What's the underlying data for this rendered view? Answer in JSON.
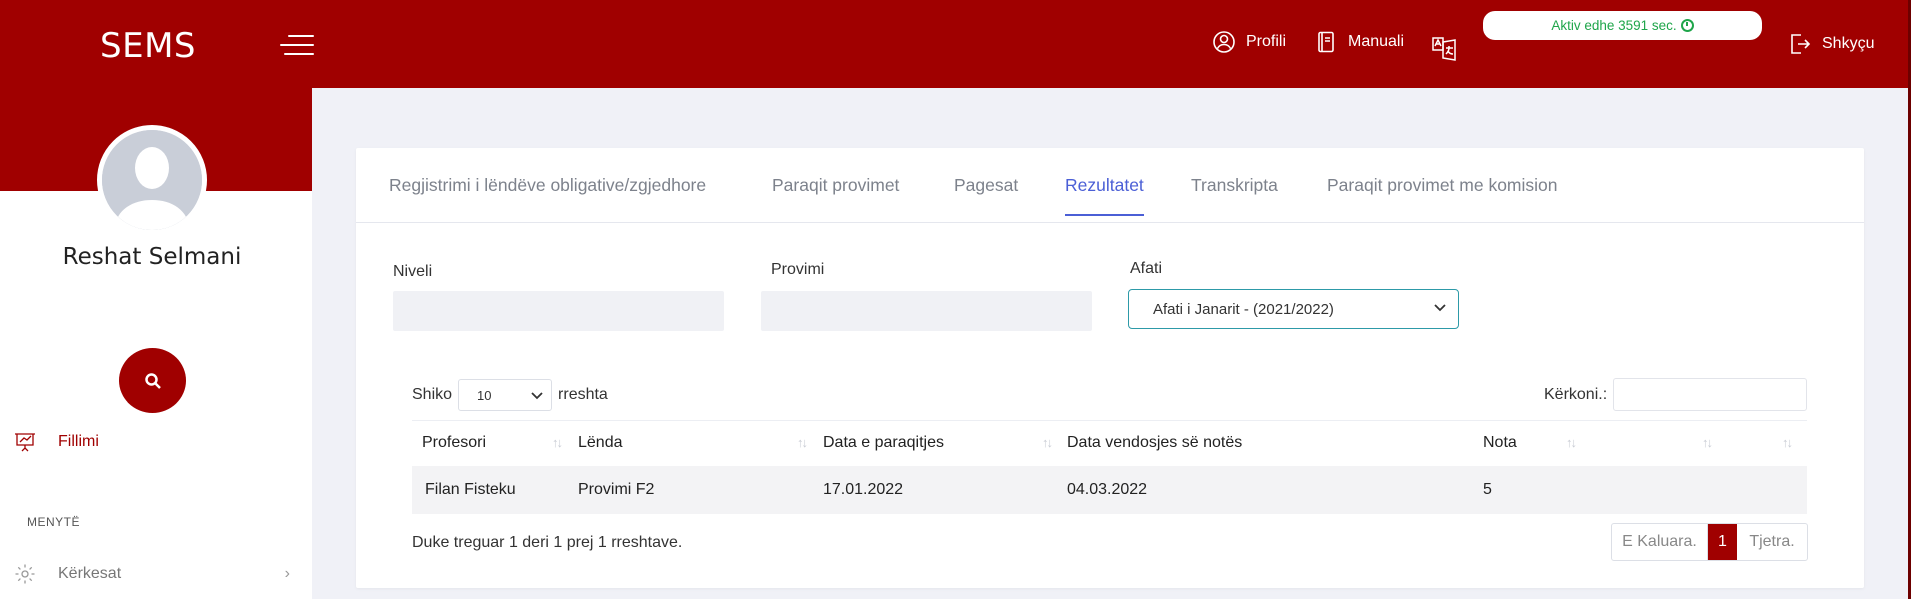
{
  "header": {
    "brand": "SEMS",
    "profili": "Profili",
    "manuali": "Manuali",
    "timer": "Aktiv edhe 3591 sec.",
    "logout": "Shkyçu",
    "accent_color": "#a00000"
  },
  "sidebar": {
    "user_name": "Reshat Selmani",
    "items": [
      {
        "label": "Fillimi",
        "icon": "chart-presentation-icon"
      },
      {
        "label": "Kërkesat",
        "icon": "gear-icon"
      }
    ],
    "section_title": "MENYTË"
  },
  "tabs": [
    {
      "label": "Regjistrimi i lëndëve obligative/zgjedhore"
    },
    {
      "label": "Paraqit provimet"
    },
    {
      "label": "Pagesat"
    },
    {
      "label": "Rezultatet",
      "active": true
    },
    {
      "label": "Transkripta"
    },
    {
      "label": "Paraqit provimet me komision"
    }
  ],
  "filters": {
    "niveli_label": "Niveli",
    "niveli_value": "",
    "provimi_label": "Provimi",
    "provimi_value": "",
    "afati_label": "Afati",
    "afati_value": "Afati i Janarit - (2021/2022)"
  },
  "table_controls": {
    "show_prefix": "Shiko",
    "page_length": "10",
    "show_suffix": "rreshta",
    "search_label": "Kërkoni.:",
    "search_value": ""
  },
  "table": {
    "headers": [
      "Profesori",
      "Lënda",
      "Data e paraqitjes",
      "Data vendosjes së notës",
      "Nota"
    ],
    "rows": [
      [
        "Filan Fisteku",
        "Provimi F2",
        "17.01.2022",
        "04.03.2022",
        "5"
      ]
    ]
  },
  "pagination": {
    "info": "Duke treguar 1 deri 1 prej 1 rreshtave.",
    "prev": "E Kaluara.",
    "current": "1",
    "next": "Tjetra."
  }
}
